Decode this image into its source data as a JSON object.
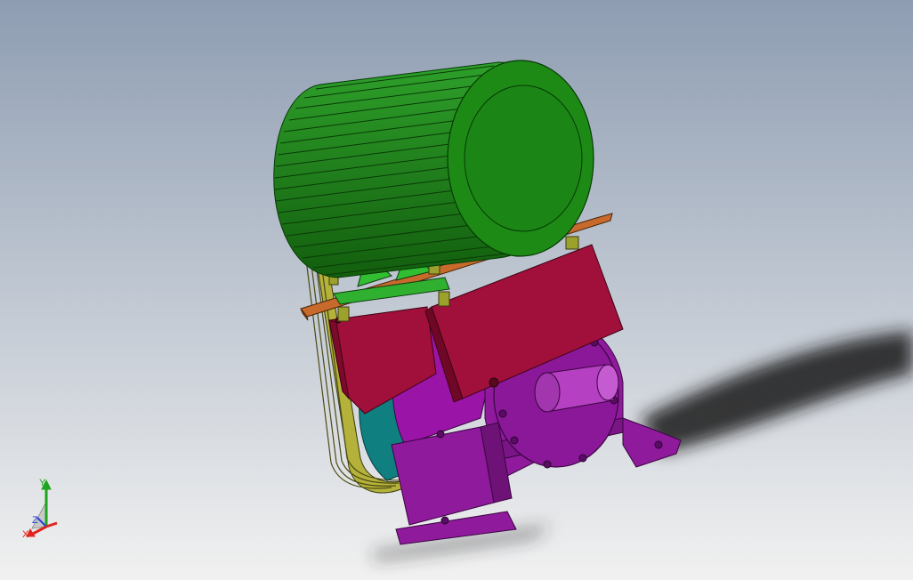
{
  "viewport": {
    "background_top": "#8e9db2",
    "background_bottom": "#f1f1f1"
  },
  "model": {
    "parts": [
      {
        "part": "motor",
        "color": "#1f8f17"
      },
      {
        "part": "motor-base-plate",
        "color": "#c76a2c"
      },
      {
        "part": "motor-mount-bracket",
        "color": "#2fb12f"
      },
      {
        "part": "bolt",
        "color": "#9ca12c"
      },
      {
        "part": "belt",
        "color": "#b4b23a"
      },
      {
        "part": "pulley",
        "color": "#0f7f7f"
      },
      {
        "part": "belt-guard",
        "color": "#a0103a"
      },
      {
        "part": "gearbox",
        "color": "#8f1a9c"
      },
      {
        "part": "output-shaft",
        "color": "#b640c2"
      }
    ]
  },
  "triad": {
    "x_label": "X",
    "y_label": "Y",
    "z_label": "Z",
    "x_color": "#e0231c",
    "y_color": "#1ea51e",
    "z_color": "#2a3fd6"
  }
}
